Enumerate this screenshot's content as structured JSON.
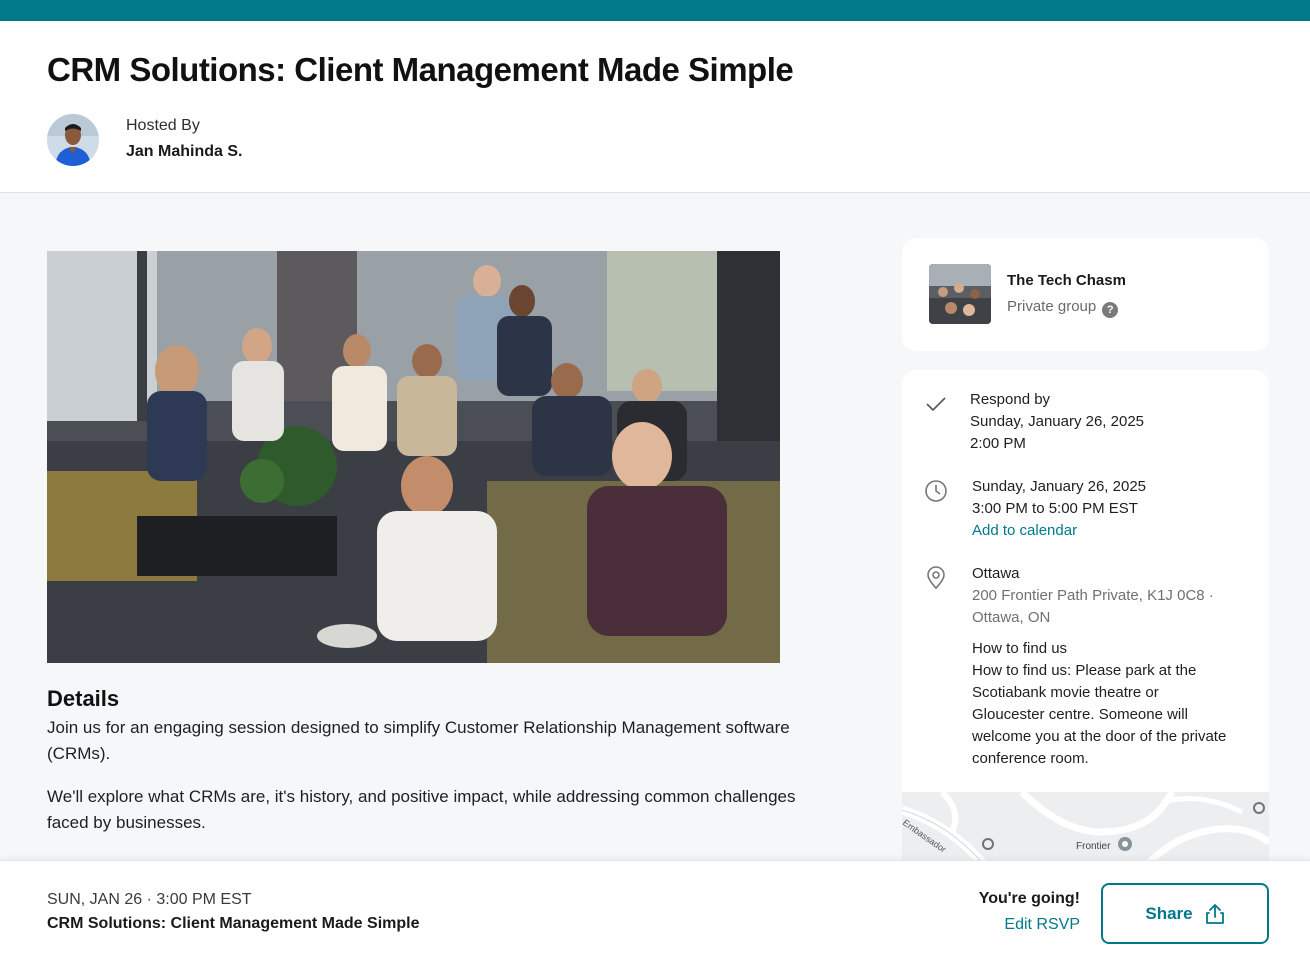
{
  "event": {
    "title": "CRM Solutions: Client Management Made Simple",
    "hosted_by_label": "Hosted By",
    "host_name": "Jan Mahinda S."
  },
  "details": {
    "heading": "Details",
    "paragraphs": [
      "Join us for an engaging session designed to simplify Customer Relationship Management software (CRMs).",
      "We'll explore what CRMs are, it's history, and positive impact, while addressing common challenges faced by businesses."
    ]
  },
  "group": {
    "name": "The Tech Chasm",
    "type": "Private group",
    "help_glyph": "?"
  },
  "respond": {
    "label": "Respond by",
    "date": "Sunday, January 26, 2025",
    "time": "2:00 PM"
  },
  "when": {
    "date": "Sunday, January 26, 2025",
    "time_range": "3:00 PM to 5:00 PM EST",
    "add_to_calendar": "Add to calendar"
  },
  "where": {
    "city": "Ottawa",
    "address_line1": "200 Frontier Path Private, K1J 0C8 ·",
    "address_line2": "Ottawa, ON",
    "how_to_find_label": "How to find us",
    "how_to_find_text": "How to find us: Please park at the Scotiabank movie theatre or Gloucester centre. Someone will welcome you at the door of the private conference room."
  },
  "map": {
    "labels": [
      "Frontier",
      "Embassador"
    ]
  },
  "footer": {
    "date_line": "SUN, JAN 26 · 3:00 PM EST",
    "title": "CRM Solutions: Client Management Made Simple",
    "going": "You're going!",
    "edit_rsvp": "Edit RSVP",
    "share": "Share"
  },
  "icons": {
    "check": "check-icon",
    "clock": "clock-icon",
    "location": "location-pin-icon",
    "share": "share-icon",
    "help": "help-icon"
  },
  "colors": {
    "brand": "#00798a",
    "page_bg": "#f6f7f8"
  }
}
